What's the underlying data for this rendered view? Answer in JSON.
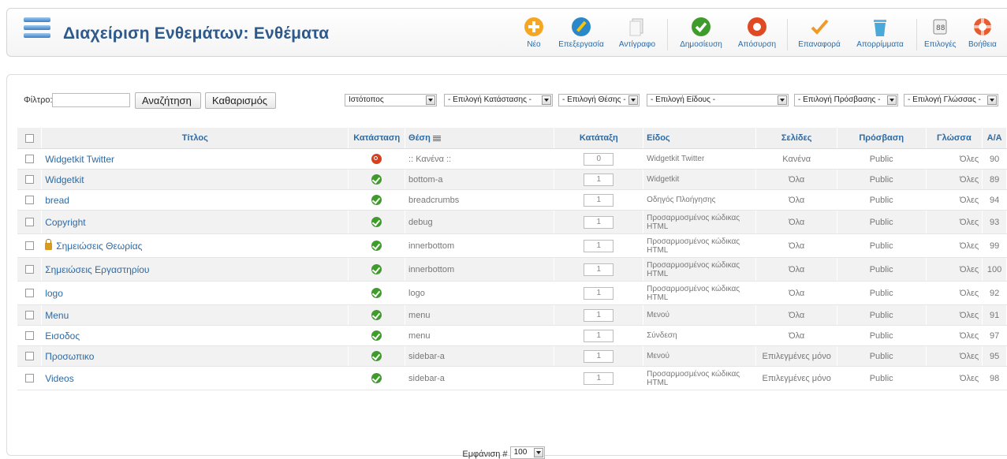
{
  "header": {
    "title": "Διαχείριση Ενθεμάτων: Ενθέματα"
  },
  "toolbar": {
    "new": "Νέο",
    "edit": "Επεξεργασία",
    "copy": "Αντίγραφο",
    "publish": "Δημοσίευση",
    "unpublish": "Απόσυρση",
    "restore": "Επαναφορά",
    "trash": "Απορρίμματα",
    "options": "Επιλογές",
    "help": "Βοήθεια"
  },
  "filter": {
    "label": "Φίλτρο:",
    "value": "",
    "search_button": "Αναζήτηση",
    "clear_button": "Καθαρισμός",
    "site_select": "Ιστότοπος",
    "state_select": "- Επιλογή Κατάστασης -",
    "position_select": "- Επιλογή Θέσης -",
    "type_select": "- Επιλογή Είδους -",
    "access_select": "- Επιλογή Πρόσβασης -",
    "language_select": "- Επιλογή Γλώσσας -"
  },
  "columns": {
    "title": "Τίτλος",
    "status": "Κατάσταση",
    "position": "Θέση",
    "ordering": "Κατάταξη",
    "type": "Είδος",
    "pages": "Σελίδες",
    "access": "Πρόσβαση",
    "language": "Γλώσσα",
    "id": "Α/Α"
  },
  "rows": [
    {
      "title": "Widgetkit Twitter",
      "status": "unpublished",
      "position": ":: Κανένα ::",
      "order": "0",
      "type": "Widgetkit Twitter",
      "pages": "Κανένα",
      "access": "Public",
      "language": "Όλες",
      "id": "90",
      "locked": false
    },
    {
      "title": "Widgetkit",
      "status": "published",
      "position": "bottom-a",
      "order": "1",
      "type": "Widgetkit",
      "pages": "Όλα",
      "access": "Public",
      "language": "Όλες",
      "id": "89",
      "locked": false
    },
    {
      "title": "bread",
      "status": "published",
      "position": "breadcrumbs",
      "order": "1",
      "type": "Οδηγός Πλοήγησης",
      "pages": "Όλα",
      "access": "Public",
      "language": "Όλες",
      "id": "94",
      "locked": false
    },
    {
      "title": "Copyright",
      "status": "published",
      "position": "debug",
      "order": "1",
      "type": "Προσαρμοσμένος κώδικας HTML",
      "pages": "Όλα",
      "access": "Public",
      "language": "Όλες",
      "id": "93",
      "locked": false
    },
    {
      "title": "Σημειώσεις Θεωρίας",
      "status": "published",
      "position": "innerbottom",
      "order": "1",
      "type": "Προσαρμοσμένος κώδικας HTML",
      "pages": "Όλα",
      "access": "Public",
      "language": "Όλες",
      "id": "99",
      "locked": true
    },
    {
      "title": "Σημειώσεις Εργαστηρίου",
      "status": "published",
      "position": "innerbottom",
      "order": "1",
      "type": "Προσαρμοσμένος κώδικας HTML",
      "pages": "Όλα",
      "access": "Public",
      "language": "Όλες",
      "id": "100",
      "locked": false
    },
    {
      "title": "logo",
      "status": "published",
      "position": "logo",
      "order": "1",
      "type": "Προσαρμοσμένος κώδικας HTML",
      "pages": "Όλα",
      "access": "Public",
      "language": "Όλες",
      "id": "92",
      "locked": false
    },
    {
      "title": "Menu",
      "status": "published",
      "position": "menu",
      "order": "1",
      "type": "Μενού",
      "pages": "Όλα",
      "access": "Public",
      "language": "Όλες",
      "id": "91",
      "locked": false
    },
    {
      "title": "Εισοδος",
      "status": "published",
      "position": "menu",
      "order": "1",
      "type": "Σύνδεση",
      "pages": "Όλα",
      "access": "Public",
      "language": "Όλες",
      "id": "97",
      "locked": false
    },
    {
      "title": "Προσωπικο",
      "status": "published",
      "position": "sidebar-a",
      "order": "1",
      "type": "Μενού",
      "pages": "Επιλεγμένες μόνο",
      "access": "Public",
      "language": "Όλες",
      "id": "95",
      "locked": false
    },
    {
      "title": "Videos",
      "status": "published",
      "position": "sidebar-a",
      "order": "1",
      "type": "Προσαρμοσμένος κώδικας HTML",
      "pages": "Επιλεγμένες μόνο",
      "access": "Public",
      "language": "Όλες",
      "id": "98",
      "locked": false
    }
  ],
  "footer": {
    "display_label": "Εμφάνιση #",
    "display_value": "100"
  },
  "colors": {
    "link": "#2d6aa3",
    "title": "#2d5a8a",
    "published": "#3f9b2b",
    "unpublished": "#d6401f"
  }
}
